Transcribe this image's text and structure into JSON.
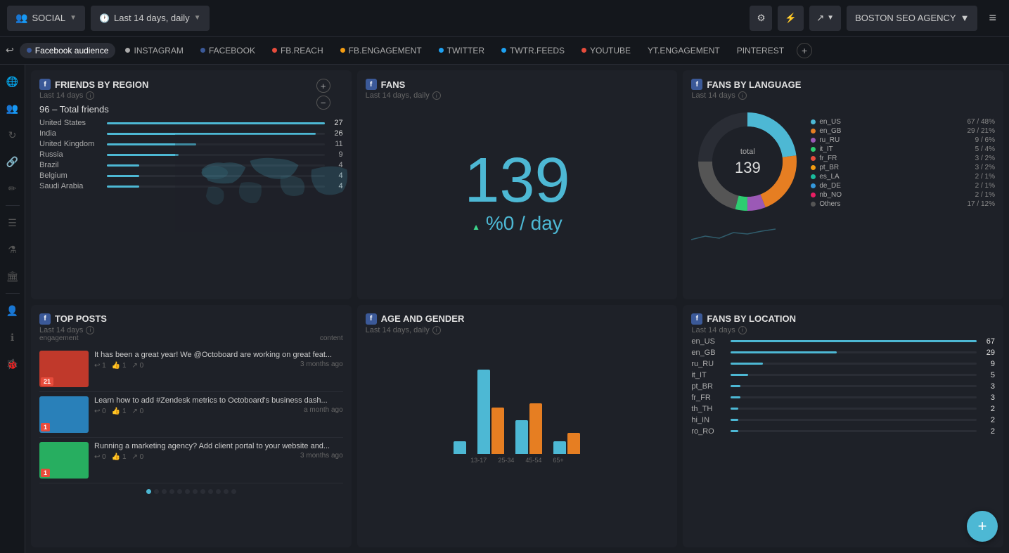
{
  "topnav": {
    "social_label": "SOCIAL",
    "date_label": "Last 14 days, daily",
    "agency_label": "BOSTON SEO AGENCY",
    "menu_icon": "≡"
  },
  "tabs": [
    {
      "label": "Facebook audience",
      "active": true,
      "color": "#3b5998"
    },
    {
      "label": "INSTAGRAM",
      "active": false,
      "color": "#aaa"
    },
    {
      "label": "FACEBOOK",
      "active": false,
      "color": "#3b5998"
    },
    {
      "label": "FB.REACH",
      "active": false,
      "color": "#e74c3c"
    },
    {
      "label": "FB.ENGAGEMENT",
      "active": false,
      "color": "#f39c12"
    },
    {
      "label": "TWITTER",
      "active": false,
      "color": "#1da1f2"
    },
    {
      "label": "TWTR.FEEDS",
      "active": false,
      "color": "#1da1f2"
    },
    {
      "label": "YOUTUBE",
      "active": false,
      "color": "#e74c3c"
    },
    {
      "label": "YT.ENGAGEMENT",
      "active": false,
      "color": "#aaa"
    },
    {
      "label": "PINTEREST",
      "active": false,
      "color": "#aaa"
    }
  ],
  "sidebar_icons": [
    "globe",
    "users",
    "refresh",
    "link",
    "edit",
    "list",
    "flask",
    "building",
    "user",
    "info",
    "bug"
  ],
  "friends_by_region": {
    "title": "FRIENDS BY REGION",
    "subtitle": "Last 14 days",
    "total": "96 – Total friends",
    "rows": [
      {
        "name": "United States",
        "value": 27,
        "max": 27,
        "color": "#4db8d4"
      },
      {
        "name": "India",
        "value": 26,
        "max": 27,
        "color": "#4db8d4"
      },
      {
        "name": "United Kingdom",
        "value": 11,
        "max": 27,
        "color": "#4db8d4"
      },
      {
        "name": "Russia",
        "value": 9,
        "max": 27,
        "color": "#4db8d4"
      },
      {
        "name": "Brazil",
        "value": 4,
        "max": 27,
        "color": "#4db8d4"
      },
      {
        "name": "Belgium",
        "value": 4,
        "max": 27,
        "color": "#4db8d4"
      },
      {
        "name": "Saudi Arabia",
        "value": 4,
        "max": 27,
        "color": "#4db8d4"
      }
    ]
  },
  "fans": {
    "title": "FANS",
    "subtitle": "Last 14 days, daily",
    "number": "139",
    "day_label": "%0 / day",
    "trend": "▲"
  },
  "fans_by_language": {
    "title": "FANS BY LANGUAGE",
    "subtitle": "Last 14 days",
    "total_label": "total",
    "total": "139",
    "segments": [
      {
        "lang": "en_US",
        "count": 67,
        "pct": "48%",
        "color": "#4db8d4"
      },
      {
        "lang": "en_GB",
        "count": 29,
        "pct": "21%",
        "color": "#e67e22"
      },
      {
        "lang": "ru_RU",
        "count": 9,
        "pct": "6%",
        "color": "#9b59b6"
      },
      {
        "lang": "it_IT",
        "count": 5,
        "pct": "4%",
        "color": "#2ecc71"
      },
      {
        "lang": "fr_FR",
        "count": 3,
        "pct": "2%",
        "color": "#e74c3c"
      },
      {
        "lang": "pt_BR",
        "count": 3,
        "pct": "2%",
        "color": "#f39c12"
      },
      {
        "lang": "es_LA",
        "count": 2,
        "pct": "1%",
        "color": "#1abc9c"
      },
      {
        "lang": "de_DE",
        "count": 2,
        "pct": "1%",
        "color": "#3498db"
      },
      {
        "lang": "nb_NO",
        "count": 2,
        "pct": "1%",
        "color": "#e91e63"
      },
      {
        "lang": "Others",
        "count": 17,
        "pct": "12%",
        "color": "#555"
      }
    ]
  },
  "top_posts": {
    "title": "TOP POSTS",
    "subtitle": "Last 14 days",
    "col1": "engagement",
    "col2": "content",
    "posts": [
      {
        "thumb_color": "#c0392b",
        "thumb_num": "21",
        "text": "It has been a great year! We @Octoboard are working on great feat...",
        "replies": "1",
        "likes": "1",
        "shares": "0",
        "time": "3 months ago"
      },
      {
        "thumb_color": "#2980b9",
        "thumb_num": "1",
        "text": "Learn how to add #Zendesk metrics to Octoboard's business dash...",
        "replies": "0",
        "likes": "1",
        "shares": "0",
        "time": "a month ago"
      },
      {
        "thumb_color": "#27ae60",
        "thumb_num": "1",
        "text": "Running a marketing agency? Add client portal to your website and...",
        "replies": "0",
        "likes": "1",
        "shares": "0",
        "time": "3 months ago"
      }
    ],
    "dots": [
      true,
      false,
      false,
      false,
      false,
      false,
      false,
      false,
      false,
      false,
      false,
      false
    ]
  },
  "age_gender": {
    "title": "AGE AND GENDER",
    "subtitle": "Last 14 days, daily",
    "labels": [
      "13-17",
      "25-34",
      "45-54",
      "65+"
    ],
    "bars": [
      {
        "male": 15,
        "female": 0,
        "label": "13-17"
      },
      {
        "male": 100,
        "female": 55,
        "label": "25-34"
      },
      {
        "male": 40,
        "female": 60,
        "label": "45-54"
      },
      {
        "male": 15,
        "female": 25,
        "label": "65+"
      }
    ]
  },
  "fans_by_location": {
    "title": "FANS BY LOCATION",
    "subtitle": "Last 14 days",
    "max": 67,
    "rows": [
      {
        "name": "en_US",
        "value": 67
      },
      {
        "name": "en_GB",
        "value": 29
      },
      {
        "name": "ru_RU",
        "value": 9
      },
      {
        "name": "it_IT",
        "value": 5
      },
      {
        "name": "pt_BR",
        "value": 3
      },
      {
        "name": "fr_FR",
        "value": 3
      },
      {
        "name": "th_TH",
        "value": 2
      },
      {
        "name": "hi_IN",
        "value": 2
      },
      {
        "name": "ro_RO",
        "value": 2
      }
    ]
  },
  "fab_label": "+"
}
